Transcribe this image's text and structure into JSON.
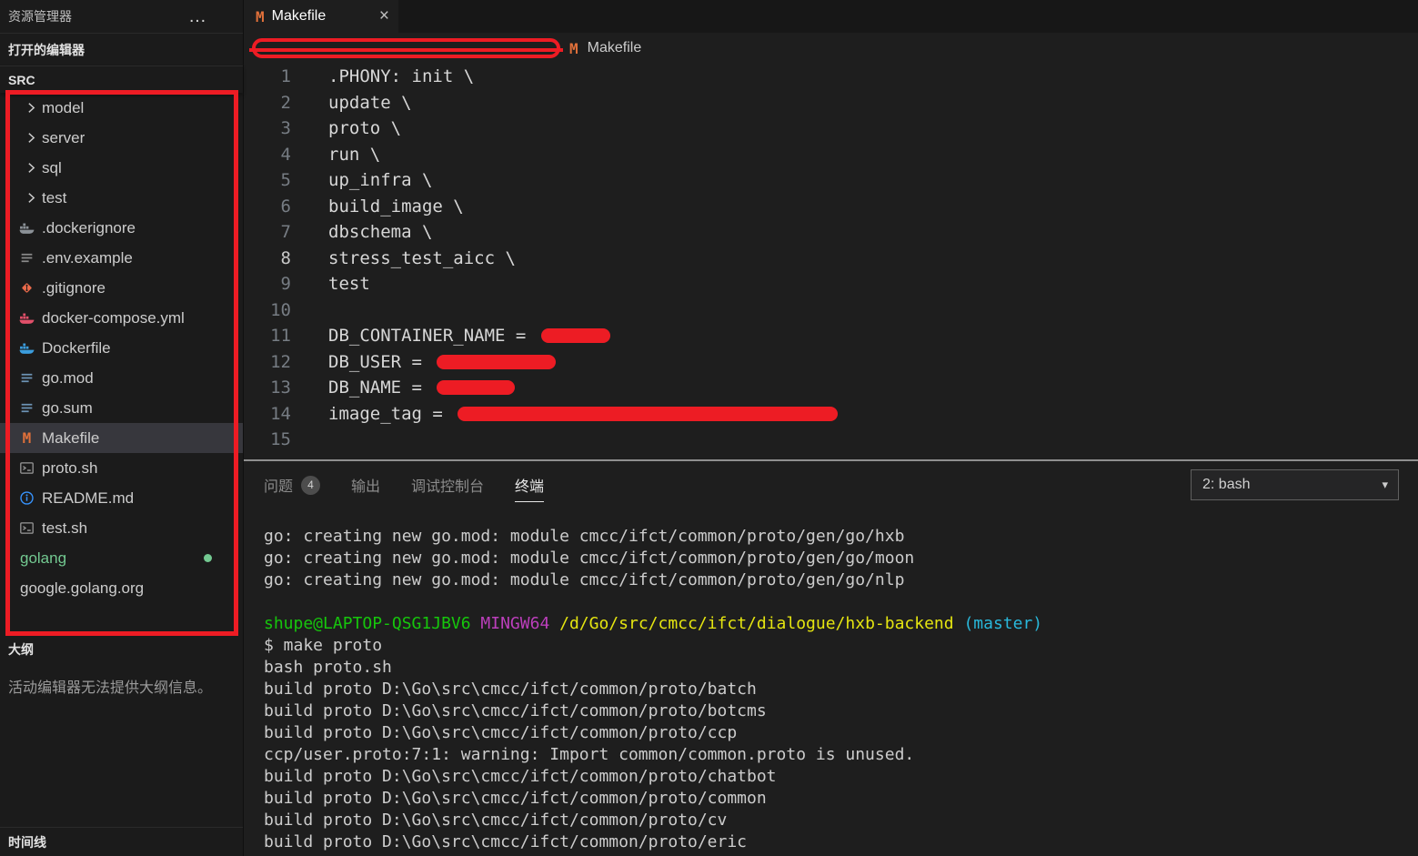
{
  "colors": {
    "annotation_red": "#ed1c24",
    "makefile_orange": "#e0703a",
    "git_green": "#73c991",
    "info_blue": "#3794ff",
    "terminal_green": "#16c60c",
    "terminal_magenta": "#bc3fbc",
    "terminal_yellow": "#e5e510",
    "terminal_cyan": "#29b8db",
    "terminal_default": "#cccccc"
  },
  "icons": {
    "more": "…",
    "close": "×",
    "chevron_down": "▾",
    "makefile_glyph": "M"
  },
  "sidebar": {
    "title": "资源管理器",
    "open_editors_label": "打开的编辑器",
    "section_label": "SRC",
    "outline_label": "大纲",
    "outline_message": "活动编辑器无法提供大纲信息。",
    "timeline_label": "时间线",
    "files": [
      {
        "label": "model",
        "kind": "folder"
      },
      {
        "label": "server",
        "kind": "folder"
      },
      {
        "label": "sql",
        "kind": "folder"
      },
      {
        "label": "test",
        "kind": "folder"
      },
      {
        "label": ".dockerignore",
        "kind": "file",
        "icon": "docker"
      },
      {
        "label": ".env.example",
        "kind": "file",
        "icon": "config-lines"
      },
      {
        "label": ".gitignore",
        "kind": "file",
        "icon": "git"
      },
      {
        "label": "docker-compose.yml",
        "kind": "file",
        "icon": "docker-compose"
      },
      {
        "label": "Dockerfile",
        "kind": "file",
        "icon": "dockerfile"
      },
      {
        "label": "go.mod",
        "kind": "file",
        "icon": "go-module"
      },
      {
        "label": "go.sum",
        "kind": "file",
        "icon": "go-module"
      },
      {
        "label": "Makefile",
        "kind": "file",
        "icon": "makefile-m",
        "selected": true
      },
      {
        "label": "proto.sh",
        "kind": "file",
        "icon": "shell"
      },
      {
        "label": "README.md",
        "kind": "file",
        "icon": "info"
      },
      {
        "label": "test.sh",
        "kind": "file",
        "icon": "shell"
      },
      {
        "label": "golang",
        "kind": "root",
        "git_status": "modified"
      },
      {
        "label": "google.golang.org",
        "kind": "root"
      }
    ]
  },
  "editor": {
    "tab": {
      "label": "Makefile"
    },
    "breadcrumb": {
      "file": "Makefile"
    },
    "lines": [
      {
        "n": 1,
        "t": ".PHONY: init \\"
      },
      {
        "n": 2,
        "t": "update \\"
      },
      {
        "n": 3,
        "t": "proto \\"
      },
      {
        "n": 4,
        "t": "run \\"
      },
      {
        "n": 5,
        "t": "up_infra \\"
      },
      {
        "n": 6,
        "t": "build_image \\"
      },
      {
        "n": 7,
        "t": "dbschema \\"
      },
      {
        "n": 8,
        "t": "stress_test_aicc \\",
        "active": true
      },
      {
        "n": 9,
        "t": "test"
      },
      {
        "n": 10,
        "t": ""
      },
      {
        "n": 11,
        "t": "DB_CONTAINER_NAME = ",
        "redact_width": 76
      },
      {
        "n": 12,
        "t": "DB_USER = ",
        "redact_width": 131
      },
      {
        "n": 13,
        "t": "DB_NAME = ",
        "redact_width": 86
      },
      {
        "n": 14,
        "t": "image_tag = ",
        "redact_width": 418
      },
      {
        "n": 15,
        "t": ""
      }
    ]
  },
  "panel": {
    "tabs": [
      {
        "label": "问题",
        "badge": "4"
      },
      {
        "label": "输出"
      },
      {
        "label": "调试控制台"
      },
      {
        "label": "终端",
        "active": true
      }
    ],
    "terminal_selector": {
      "value": "2: bash"
    },
    "terminal_lines": [
      {
        "text": "go: creating new go.mod: module cmcc/ifct/common/proto/gen/go/hxb"
      },
      {
        "text": "go: creating new go.mod: module cmcc/ifct/common/proto/gen/go/moon"
      },
      {
        "text": "go: creating new go.mod: module cmcc/ifct/common/proto/gen/go/nlp"
      },
      {
        "text": ""
      },
      {
        "segments": [
          {
            "text": "shupe@LAPTOP-QSG1JBV6",
            "color": "green"
          },
          {
            "text": " ",
            "color": "default"
          },
          {
            "text": "MINGW64",
            "color": "magenta"
          },
          {
            "text": " ",
            "color": "default"
          },
          {
            "text": "/d/Go/src/cmcc/ifct/dialogue/hxb-backend",
            "color": "yellow"
          },
          {
            "text": " ",
            "color": "default"
          },
          {
            "text": "(master)",
            "color": "cyan"
          }
        ]
      },
      {
        "text": "$ make proto"
      },
      {
        "text": "bash proto.sh"
      },
      {
        "text": "build proto D:\\Go\\src\\cmcc/ifct/common/proto/batch"
      },
      {
        "text": "build proto D:\\Go\\src\\cmcc/ifct/common/proto/botcms"
      },
      {
        "text": "build proto D:\\Go\\src\\cmcc/ifct/common/proto/ccp"
      },
      {
        "text": "ccp/user.proto:7:1: warning: Import common/common.proto is unused."
      },
      {
        "text": "build proto D:\\Go\\src\\cmcc/ifct/common/proto/chatbot"
      },
      {
        "text": "build proto D:\\Go\\src\\cmcc/ifct/common/proto/common"
      },
      {
        "text": "build proto D:\\Go\\src\\cmcc/ifct/common/proto/cv"
      },
      {
        "text": "build proto D:\\Go\\src\\cmcc/ifct/common/proto/eric"
      }
    ]
  }
}
